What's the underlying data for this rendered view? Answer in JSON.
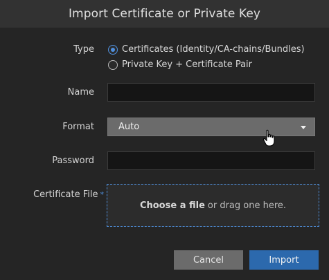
{
  "dialog": {
    "title": "Import Certificate or Private Key"
  },
  "form": {
    "type_label": "Type",
    "type_options": [
      {
        "label": "Certificates (Identity/CA-chains/Bundles)",
        "checked": true
      },
      {
        "label": "Private Key + Certificate Pair",
        "checked": false
      }
    ],
    "name_label": "Name",
    "name_value": "",
    "format_label": "Format",
    "format_value": "Auto",
    "password_label": "Password",
    "password_value": "",
    "file_label": "Certificate File",
    "file_required_marker": "*",
    "file_drop_bold": "Choose a file",
    "file_drop_rest": "or drag one here."
  },
  "buttons": {
    "cancel_label": "Cancel",
    "import_label": "Import"
  },
  "colors": {
    "accent": "#4f8fdc",
    "primary_button": "#2c69ad",
    "secondary_button": "#6b6b6b",
    "background": "#252525",
    "header": "#323232"
  },
  "icons": {
    "format_caret": "chevron-down-icon",
    "pointer": "hand-cursor-icon"
  }
}
